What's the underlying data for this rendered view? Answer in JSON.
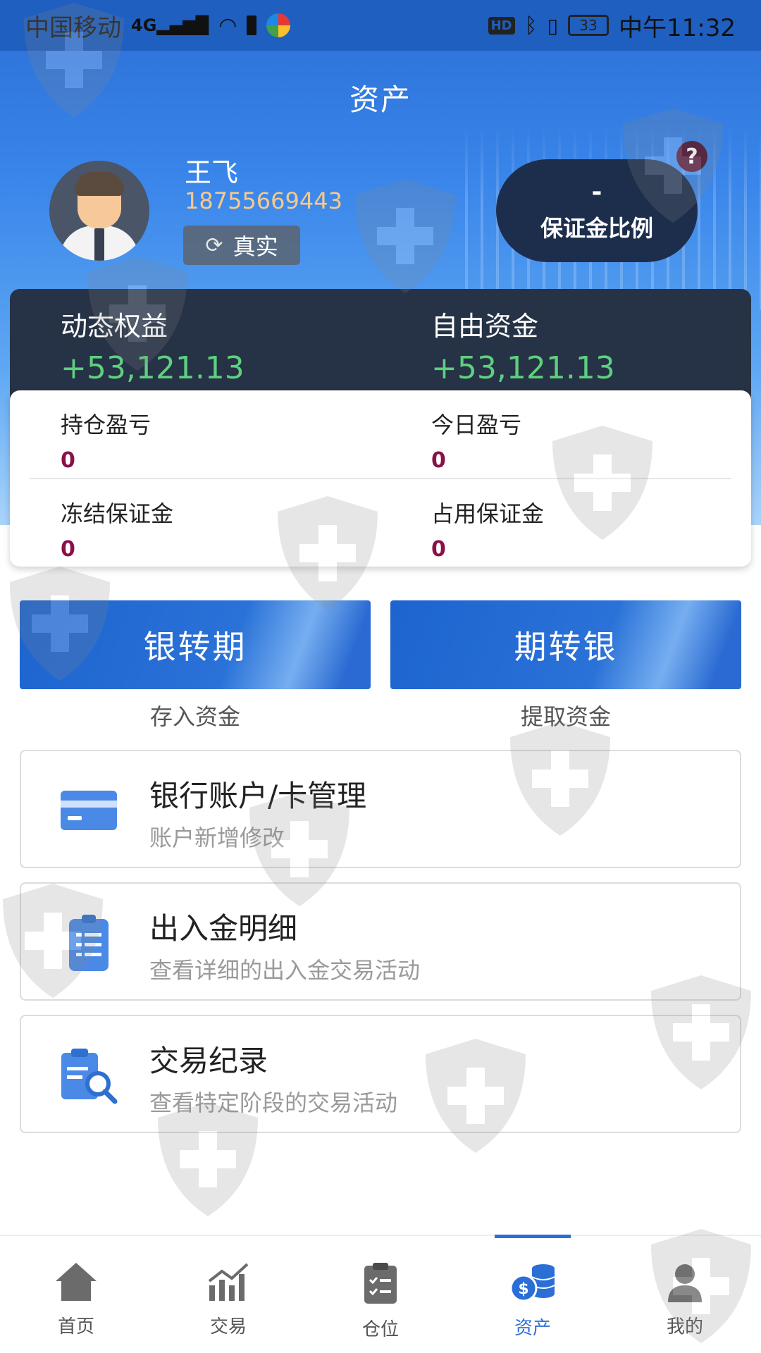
{
  "status_bar": {
    "carrier": "中国移动",
    "network": "4G",
    "battery": "33",
    "time": "中午11:32"
  },
  "header": {
    "title": "资产"
  },
  "profile": {
    "name": "王飞",
    "phone": "18755669443",
    "account_type": "真实",
    "margin_ratio_value": "-",
    "margin_ratio_label": "保证金比例",
    "help_glyph": "?"
  },
  "summary": {
    "dynamic_equity_label": "动态权益",
    "dynamic_equity_value": "+53,121.13",
    "free_funds_label": "自由资金",
    "free_funds_value": "+53,121.13"
  },
  "stats": {
    "position_pl_label": "持仓盈亏",
    "position_pl_value": "0",
    "today_pl_label": "今日盈亏",
    "today_pl_value": "0",
    "frozen_margin_label": "冻结保证金",
    "frozen_margin_value": "0",
    "used_margin_label": "占用保证金",
    "used_margin_value": "0"
  },
  "transfer": {
    "bank_to_futures_label": "银转期",
    "bank_to_futures_sub": "存入资金",
    "futures_to_bank_label": "期转银",
    "futures_to_bank_sub": "提取资金"
  },
  "menu": [
    {
      "title": "银行账户/卡管理",
      "subtitle": "账户新增修改",
      "icon": "bank-card-icon"
    },
    {
      "title": "出入金明细",
      "subtitle": "查看详细的出入金交易活动",
      "icon": "clipboard-list-icon"
    },
    {
      "title": "交易纪录",
      "subtitle": "查看特定阶段的交易活动",
      "icon": "record-search-icon"
    }
  ],
  "nav": [
    {
      "label": "首页",
      "icon": "home-icon"
    },
    {
      "label": "交易",
      "icon": "trade-chart-icon"
    },
    {
      "label": "仓位",
      "icon": "position-clipboard-icon"
    },
    {
      "label": "资产",
      "icon": "assets-coins-icon",
      "active": true
    },
    {
      "label": "我的",
      "icon": "user-icon"
    }
  ],
  "colors": {
    "primary": "#2b6fd6",
    "dark_card": "#263246",
    "positive": "#5ed07f",
    "stat_value": "#8a1048",
    "phone": "#f7c98c"
  }
}
